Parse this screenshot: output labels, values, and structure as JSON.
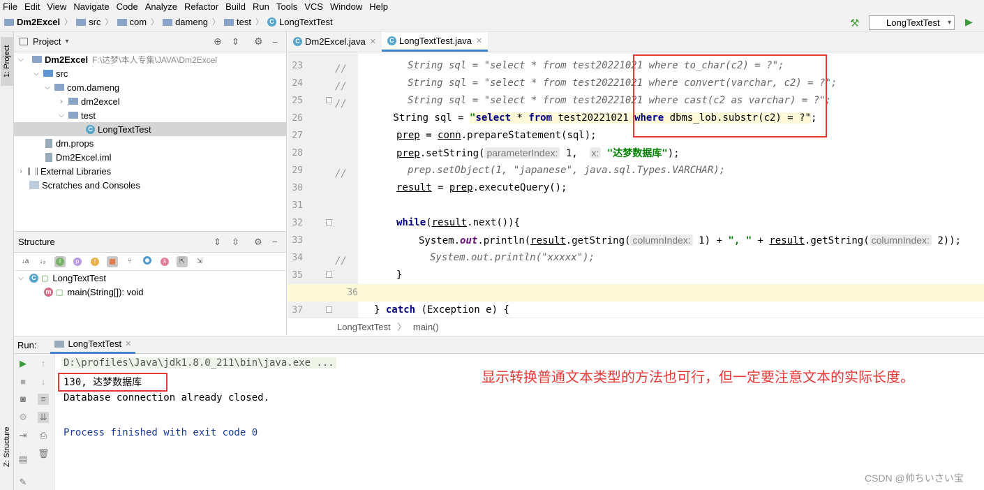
{
  "menu": [
    "File",
    "Edit",
    "View",
    "Navigate",
    "Code",
    "Analyze",
    "Refactor",
    "Build",
    "Run",
    "Tools",
    "VCS",
    "Window",
    "Help"
  ],
  "breadcrumb": [
    "Dm2Excel",
    "src",
    "com",
    "dameng",
    "test",
    "LongTextTest"
  ],
  "run_config": "LongTextTest",
  "side_tabs": {
    "project": "1: Project",
    "structure": "Z: Structure"
  },
  "project": {
    "title": "Project",
    "tree": [
      {
        "label": "Dm2Excel",
        "extra": "F:\\达梦\\本人专集\\JAVA\\Dm2Excel",
        "bold": true
      },
      {
        "label": "src"
      },
      {
        "label": "com.dameng"
      },
      {
        "label": "dm2excel"
      },
      {
        "label": "test"
      },
      {
        "label": "LongTextTest"
      },
      {
        "label": "dm.props"
      },
      {
        "label": "Dm2Excel.iml"
      },
      {
        "label": "External Libraries"
      },
      {
        "label": "Scratches and Consoles"
      }
    ]
  },
  "structure": {
    "title": "Structure",
    "class_name": "LongTextTest",
    "method": "main(String[]): void"
  },
  "editor": {
    "tabs": [
      "Dm2Excel.java",
      "LongTextTest.java"
    ],
    "line_numbers": [
      "23",
      "24",
      "25",
      "26",
      "27",
      "28",
      "29",
      "30",
      "31",
      "32",
      "33",
      "34",
      "35",
      "36",
      "37"
    ],
    "lines": {
      "l23_comment": "String sql = \"select * from test20221021 where to_char(c2) = ?\";",
      "l24_comment": "String sql = \"select * from test20221021 where convert(varchar, c2) = ?\";",
      "l25_comment": "String sql = \"select * from test20221021 where cast(c2 as varchar) = ?\";",
      "l26_pre": "        String sql = ",
      "l26_q": "\"",
      "l26_select": "select",
      "l26_mid": " * ",
      "l26_from": "from",
      "l26_tbl": " test20221021 ",
      "l26_where": "where",
      "l26_rest": " dbms_lob.substr(c2) = ?\"",
      "l26_end": ";",
      "l27_prep": "prep",
      "l27_eq": " = ",
      "l27_conn": "conn",
      "l27_rest": ".prepareStatement(sql);",
      "l28_prep": "prep",
      "l28_call": ".setString(",
      "l28_hint1": "parameterIndex:",
      "l28_val1": " 1,  ",
      "l28_hint2": "x:",
      "l28_str": " \"达梦数据库\"",
      "l28_end": ");",
      "l29_comment": "prep.setObject(1, \"japanese\", java.sql.Types.VARCHAR);",
      "l30_result": "result",
      "l30_eq": " = ",
      "l30_prep": "prep",
      "l30_rest": ".executeQuery();",
      "l32_while": "while",
      "l32_open": "(",
      "l32_result": "result",
      "l32_rest": ".next()){",
      "l33_sys": "System.",
      "l33_out": "out",
      "l33_p1": ".println(",
      "l33_result": "result",
      "l33_p2": ".getString(",
      "l33_hint": "columnIndex:",
      "l33_v1": " 1) + ",
      "l33_str": "\", \"",
      "l33_plus": " + ",
      "l33_result2": "result",
      "l33_p3": ".getString(",
      "l33_hint2": "columnIndex:",
      "l33_end": " 2));",
      "l34_comment": "System.out.println(\"xxxxx\");",
      "l35": "}",
      "l37_brace": "} ",
      "l37_catch": "catch",
      "l37_rest": " (Exception e) {"
    },
    "breadcrumb": [
      "LongTextTest",
      "main()"
    ]
  },
  "run": {
    "label": "Run:",
    "tab": "LongTextTest",
    "console": [
      "D:\\profiles\\Java\\jdk1.8.0_211\\bin\\java.exe ...",
      "130, 达梦数据库",
      "Database connection already closed.",
      "",
      "Process finished with exit code 0"
    ]
  },
  "annotation": "显示转换普通文本类型的方法也可行，但一定要注意文本的实际长度。",
  "watermark": "CSDN @帅ちいさい宝"
}
